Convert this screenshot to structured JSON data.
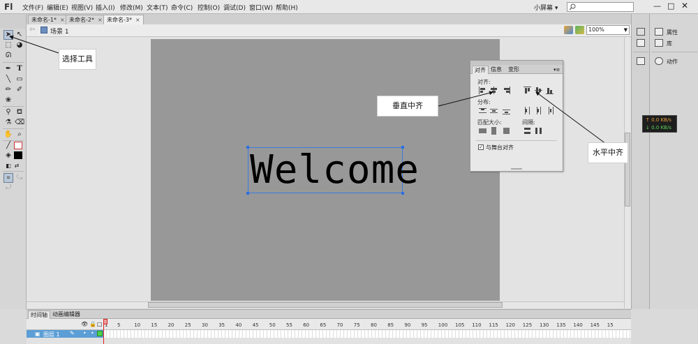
{
  "app": {
    "logo": "Fl"
  },
  "menu": [
    "文件(F)",
    "编辑(E)",
    "视图(V)",
    "插入(I)",
    "修改(M)",
    "文本(T)",
    "命令(C)",
    "控制(O)",
    "调试(D)",
    "窗口(W)",
    "帮助(H)"
  ],
  "workspace": "小屏幕 ▾",
  "search": {
    "placeholder": "",
    "icon": "search-icon"
  },
  "window_controls": {
    "minimize": "—",
    "maximize": "□",
    "close": "✕"
  },
  "doc_tabs": [
    {
      "label": "未命名-1*",
      "close": "×"
    },
    {
      "label": "未命名-2*",
      "close": "×"
    },
    {
      "label": "未命名-3*",
      "close": "×"
    }
  ],
  "scene": {
    "label": "场景 1",
    "back": "⇦"
  },
  "zoom": "100%",
  "stage_text": "Welcome",
  "colors": {
    "stage": "#989898",
    "selection": "#3a7be0",
    "accent": "#5c9ed6"
  },
  "align_panel": {
    "tabs": [
      "对齐",
      "信息",
      "变形"
    ],
    "menu": "▾≡",
    "section_align": "对齐:",
    "section_distribute": "分布:",
    "section_match": "匹配大小:",
    "section_spacing": "间隔:",
    "to_stage_label": "与舞台对齐",
    "to_stage_checked": "✓"
  },
  "right_panel": {
    "properties": "属性",
    "library": "库",
    "actions": "动作"
  },
  "net": {
    "up": "↑ 0.0 KB/s",
    "down": "↓ 0.0 KB/s"
  },
  "timeline": {
    "tabs": [
      "时间轴",
      "动画编辑器"
    ],
    "layer_name": "图层 1",
    "ticks": [
      "1",
      "5",
      "10",
      "15",
      "20",
      "25",
      "30",
      "35",
      "40",
      "45",
      "50",
      "55",
      "60",
      "65",
      "70",
      "75",
      "80",
      "85",
      "90",
      "95",
      "100",
      "105",
      "110",
      "115",
      "120",
      "125",
      "130",
      "135",
      "140",
      "145",
      "15"
    ]
  },
  "annotations": {
    "select_tool": "选择工具",
    "vertical_center": "垂直中齐",
    "horizontal_center": "水平中齐"
  }
}
